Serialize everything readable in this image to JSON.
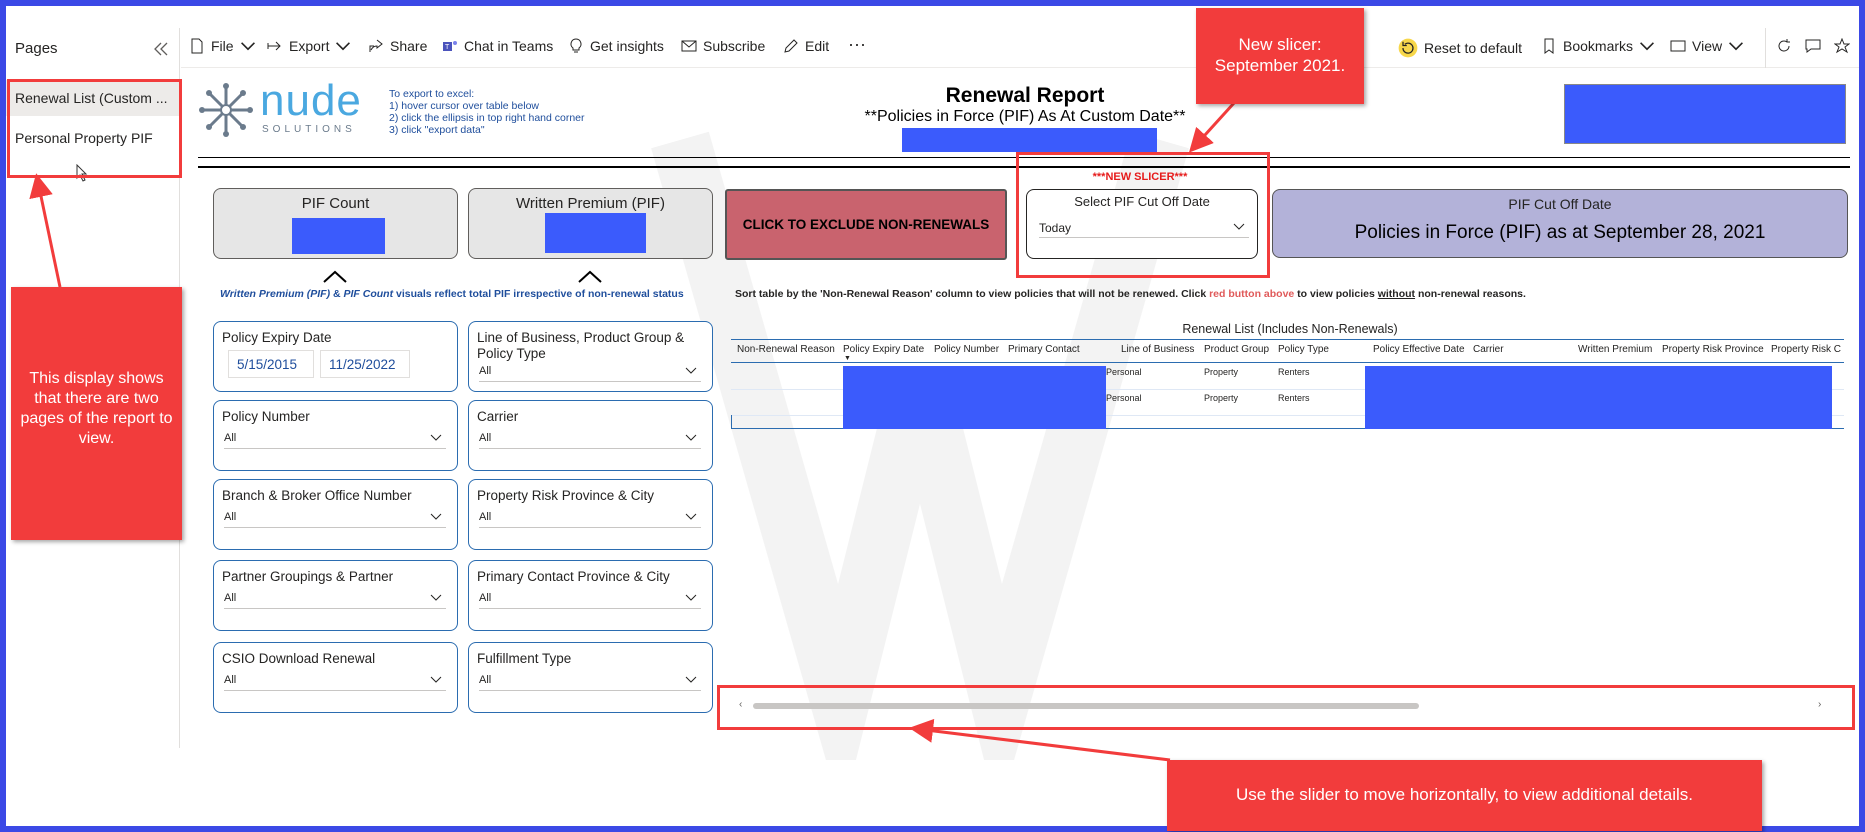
{
  "pages_pane": {
    "title": "Pages",
    "items": [
      {
        "label": "Renewal List (Custom ..."
      },
      {
        "label": "Personal Property PIF"
      }
    ]
  },
  "toolbar": {
    "file": "File",
    "export": "Export",
    "share": "Share",
    "chat": "Chat in Teams",
    "insights": "Get insights",
    "subscribe": "Subscribe",
    "edit": "Edit",
    "more": "···",
    "reset": "Reset to default",
    "bookmarks": "Bookmarks",
    "view": "View"
  },
  "report": {
    "logo_word": "nude",
    "logo_sub": "SOLUTIONS",
    "export_help": [
      "To export to excel:",
      "1) hover cursor over table below",
      "2) click the ellipsis in top right hand corner",
      "3) click \"export data\""
    ],
    "title": "Renewal Report",
    "subtitle": "**Policies in Force (PIF) As At Custom Date**",
    "pif_count_label": "PIF Count",
    "written_premium_label": "Written Premium (PIF)",
    "exclude_button": "CLICK TO EXCLUDE NON-RENEWALS",
    "new_slicer_tag": "***NEW SLICER***",
    "slicer_label": "Select PIF Cut Off Date",
    "slicer_value": "Today",
    "cutoff_label": "PIF Cut Off Date",
    "cutoff_value": "Policies in Force (PIF) as at September 28, 2021",
    "note_part1": "Written Premium (PIF)",
    "note_part2": " & ",
    "note_part3": "PIF Count",
    "note_part4": " visuals reflect total PIF irrespective of non-renewal status",
    "sort_text_1": "Sort table by the 'Non-Renewal Reason' column to view policies that will not be renewed. Click ",
    "sort_text_red": "red button above",
    "sort_text_2": " to view policies ",
    "sort_text_u": "without",
    "sort_text_3": " non-renewal reasons.",
    "table_title": "Renewal List (Includes Non-Renewals)",
    "columns": [
      "Non-Renewal Reason",
      "Policy Expiry Date",
      "Policy Number",
      "Primary Contact",
      "Line of Business",
      "Product Group",
      "Policy Type",
      "Policy Effective Date",
      "Carrier",
      "Written Premium",
      "Property Risk Province",
      "Property Risk Ci"
    ],
    "rows": [
      {
        "lob": "Personal",
        "group": "Property",
        "type": "Renters"
      },
      {
        "lob": "Personal",
        "group": "Property",
        "type": "Renters"
      }
    ]
  },
  "filters": {
    "expiry": {
      "label": "Policy Expiry Date",
      "from": "5/15/2015",
      "to": "11/25/2022"
    },
    "lob": {
      "label": "Line of Business, Product Group & Policy Type",
      "value": "All"
    },
    "policy_number": {
      "label": "Policy Number",
      "value": "All"
    },
    "carrier": {
      "label": "Carrier",
      "value": "All"
    },
    "branch": {
      "label": "Branch & Broker Office Number",
      "value": "All"
    },
    "risk_province": {
      "label": "Property Risk Province & City",
      "value": "All"
    },
    "partner": {
      "label": "Partner Groupings & Partner",
      "value": "All"
    },
    "contact_province": {
      "label": "Primary Contact Province & City",
      "value": "All"
    },
    "csio": {
      "label": "CSIO Download Renewal",
      "value": "All"
    },
    "fulfillment": {
      "label": "Fulfillment Type",
      "value": "All"
    }
  },
  "callouts": {
    "slicer": "New slicer: September 2021.",
    "pages": "This display shows that there are two pages of the report to view.",
    "slider": "Use the slider to move horizontally, to view additional details."
  },
  "colors": {
    "frame": "#3b49e6",
    "callout_red": "#f23c3c",
    "redacted_blue": "#3b5bfc",
    "exclude_button": "#c9636e",
    "cutoff_card": "#b3b2d9"
  }
}
